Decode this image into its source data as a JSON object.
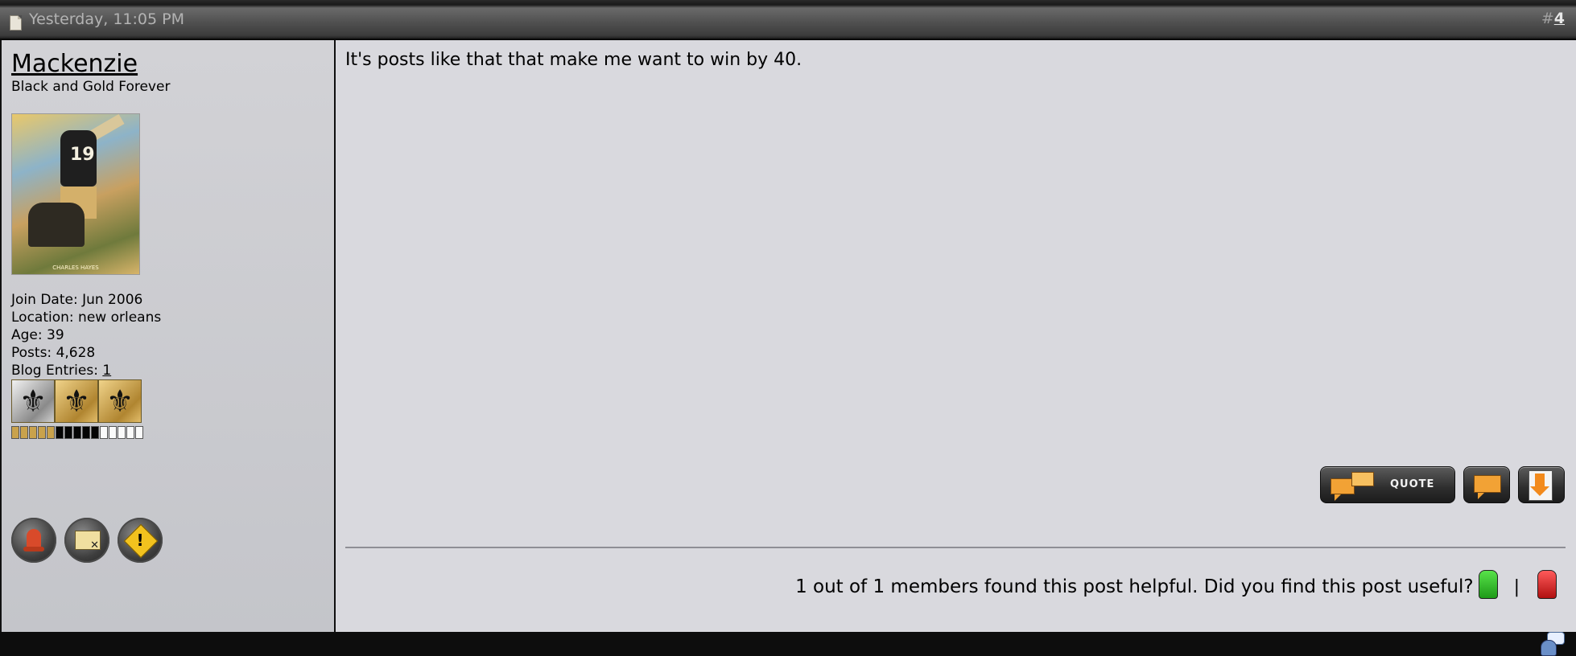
{
  "post": {
    "date": "Yesterday, 11:05 PM",
    "number_prefix": "#",
    "number": "4"
  },
  "user": {
    "name": "Mackenzie",
    "title": "Black and Gold Forever",
    "avatar_caption": "CHARLES HAYES",
    "jersey_number": "19",
    "stats": [
      {
        "label": "Join Date:",
        "value": "Jun 2006"
      },
      {
        "label": "Location:",
        "value": "new orleans"
      },
      {
        "label": "Age:",
        "value": "39"
      },
      {
        "label": "Posts:",
        "value": "4,628"
      }
    ],
    "blog_label": "Blog Entries:",
    "blog_value": "1",
    "badges": [
      "silver-fleur-de-lis-icon",
      "gold-fleur-de-lis-icon",
      "gold-fleur-de-lis-icon"
    ],
    "reputation": {
      "gold": 5,
      "black": 5,
      "white": 5
    },
    "actions": [
      "offline-icon",
      "private-message-icon",
      "report-post-icon"
    ]
  },
  "message": "It's posts like that that make me want to win by 40.",
  "buttons": {
    "quote_label": "QUOTE"
  },
  "helpful": {
    "text": "1 out of 1 members found this post helpful. Did you find this post useful?",
    "separator": "|"
  },
  "colors": {
    "header_bg": "#4e4e4e",
    "user_column_bg": "#cbcbd0",
    "content_bg": "#d9d9de",
    "quote_bubble": "#f2a235",
    "rep_gold": "#c9a24c"
  }
}
